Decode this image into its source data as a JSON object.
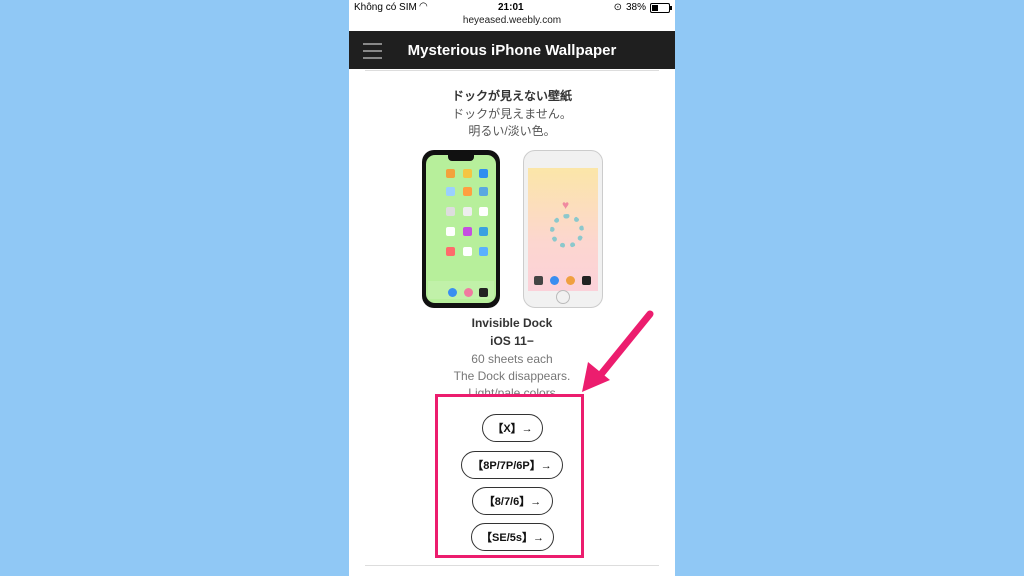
{
  "status_bar": {
    "carrier": "Không có SIM",
    "time": "21:01",
    "battery": "38%",
    "battery_level": 0.38
  },
  "address_bar": {
    "url": "heyeased.weebly.com"
  },
  "nav": {
    "title": "Mysterious iPhone Wallpaper"
  },
  "jp_section": {
    "title": "ドックが見えない壁紙",
    "line1": "ドックが見えません。",
    "line2": "明るい/淡い色。"
  },
  "en_section": {
    "title": "Invisible Dock",
    "subtitle": "iOS 11−",
    "line1": "60 sheets each",
    "line2": "The Dock disappears.",
    "line3": "Light/pale colors"
  },
  "buttons": [
    {
      "label": "【X】→"
    },
    {
      "label": "【8P/7P/6P】→"
    },
    {
      "label": "【8/7/6】→"
    },
    {
      "label": "【SE/5s】→"
    }
  ],
  "colors": {
    "background": "#90c8f5",
    "navbar": "#1f1f1f",
    "highlight": "#ec1d6e"
  },
  "icons": [
    "hamburger-menu-icon",
    "wifi-icon",
    "orientation-lock-icon",
    "battery-icon",
    "arrow-icon"
  ]
}
